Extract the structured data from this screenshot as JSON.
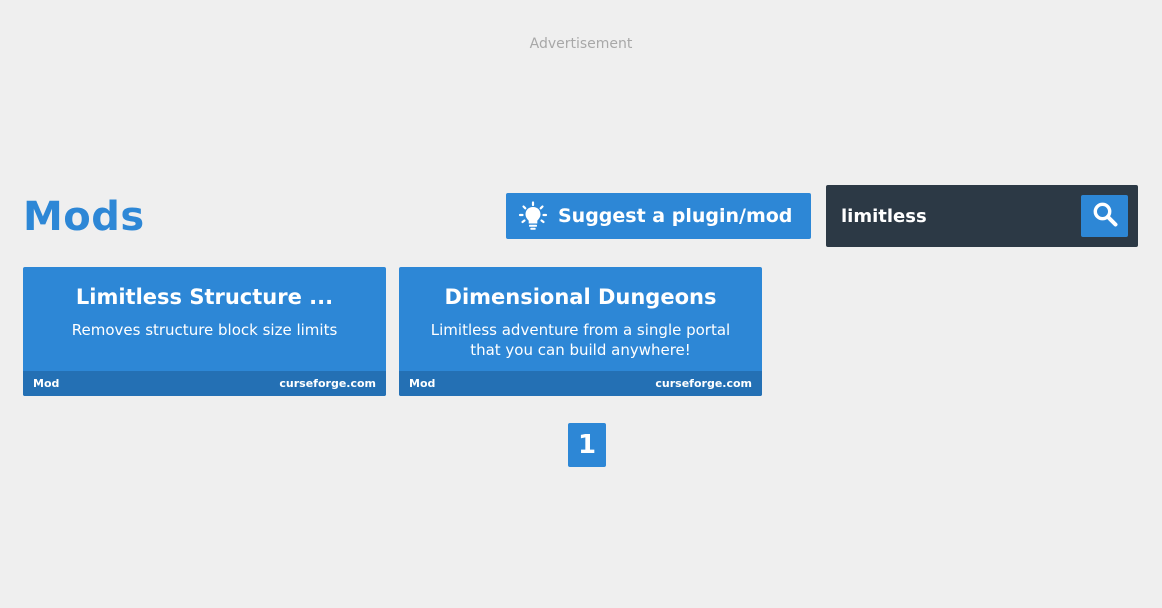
{
  "advertisement": {
    "label": "Advertisement"
  },
  "header": {
    "title": "Mods",
    "suggest_button": {
      "label": "Suggest a plugin/mod",
      "icon": "lightbulb-icon"
    },
    "search": {
      "value": "limitless",
      "placeholder": "",
      "button_icon": "search-icon"
    }
  },
  "results": [
    {
      "title": "Limitless Structure ...",
      "description": "Removes structure block size limits",
      "type": "Mod",
      "source": "curseforge.com"
    },
    {
      "title": "Dimensional Dungeons",
      "description": "Limitless adventure from a single portal that you can build anywhere!",
      "type": "Mod",
      "source": "curseforge.com"
    }
  ],
  "pagination": {
    "current_page": "1"
  },
  "colors": {
    "background": "#efefef",
    "accent": "#2d87d6",
    "accent_dark": "#2470b4",
    "search_background": "#2c3945",
    "muted_text": "#a8a8a8"
  }
}
